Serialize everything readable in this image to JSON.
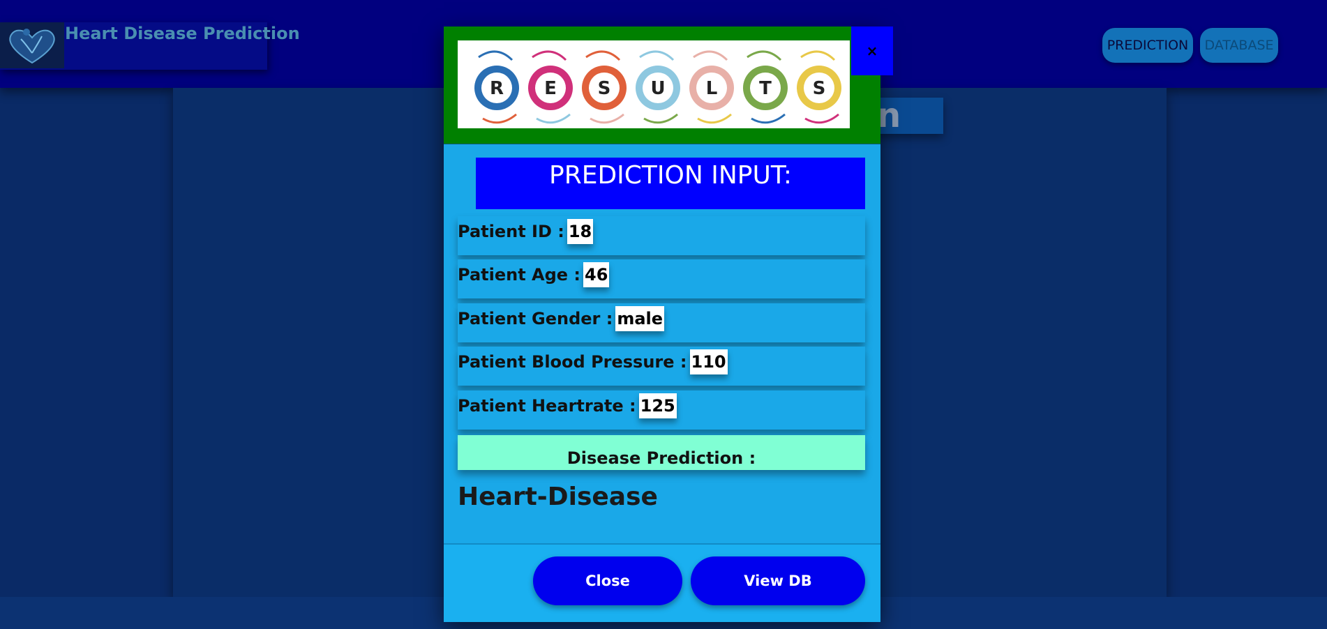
{
  "nav": {
    "brand_title": "Heart Disease Prediction",
    "brand_icon": "heart-logo-icon",
    "prediction_label": "PREDICTION",
    "database_label": "DATABASE"
  },
  "background": {
    "heading_partial": "on"
  },
  "modal": {
    "banner_letters": [
      "R",
      "E",
      "S",
      "U",
      "L",
      "T",
      "S"
    ],
    "close_symbol": "×",
    "input_heading": "PREDICTION INPUT:",
    "fields": [
      {
        "label": "Patient ID :",
        "value": "18"
      },
      {
        "label": "Patient Age :",
        "value": "46"
      },
      {
        "label": "Patient Gender :",
        "value": "male"
      },
      {
        "label": "Patient Blood Pressure :",
        "value": "110"
      },
      {
        "label": "Patient Heartrate :",
        "value": "125"
      }
    ],
    "prediction_label": "Disease Prediction :",
    "prediction_result": "Heart-Disease",
    "close_button": "Close",
    "view_db_button": "View DB"
  },
  "colors": {
    "nav_bg": "#01007f",
    "modal_bg": "#1aa8e8",
    "header_green": "#008000",
    "accent_blue": "#0000ff",
    "prediction_box": "#80ffd4"
  }
}
